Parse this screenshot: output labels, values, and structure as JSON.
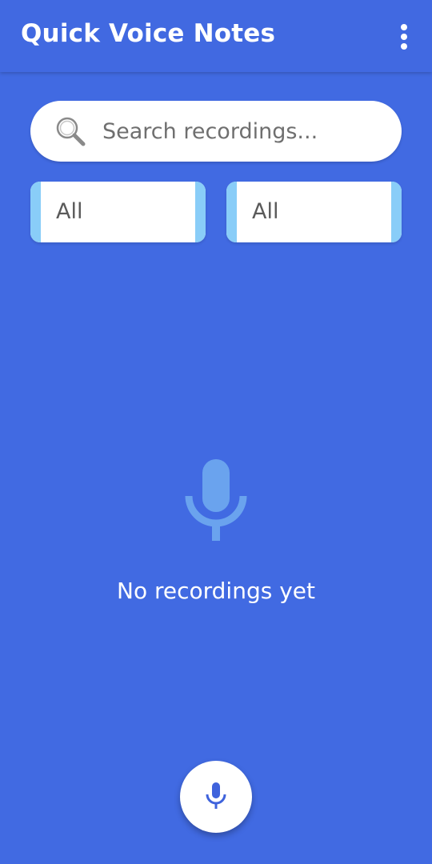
{
  "app_bar": {
    "title": "Quick Voice Notes",
    "menu_icon": "more-vert-icon"
  },
  "search": {
    "placeholder": "Search recordings...",
    "value": "",
    "icon": "search-icon"
  },
  "filters": [
    {
      "selected": "All"
    },
    {
      "selected": "All"
    }
  ],
  "empty_state": {
    "icon": "microphone-icon",
    "message": "No recordings yet"
  },
  "fab": {
    "icon": "microphone-icon"
  },
  "colors": {
    "background": "#416ae2",
    "app_bar": "#4169e1",
    "accent_light": "#89cdf8",
    "mic_faded": "#6aa3ee",
    "fab_icon": "#3f63dc"
  }
}
